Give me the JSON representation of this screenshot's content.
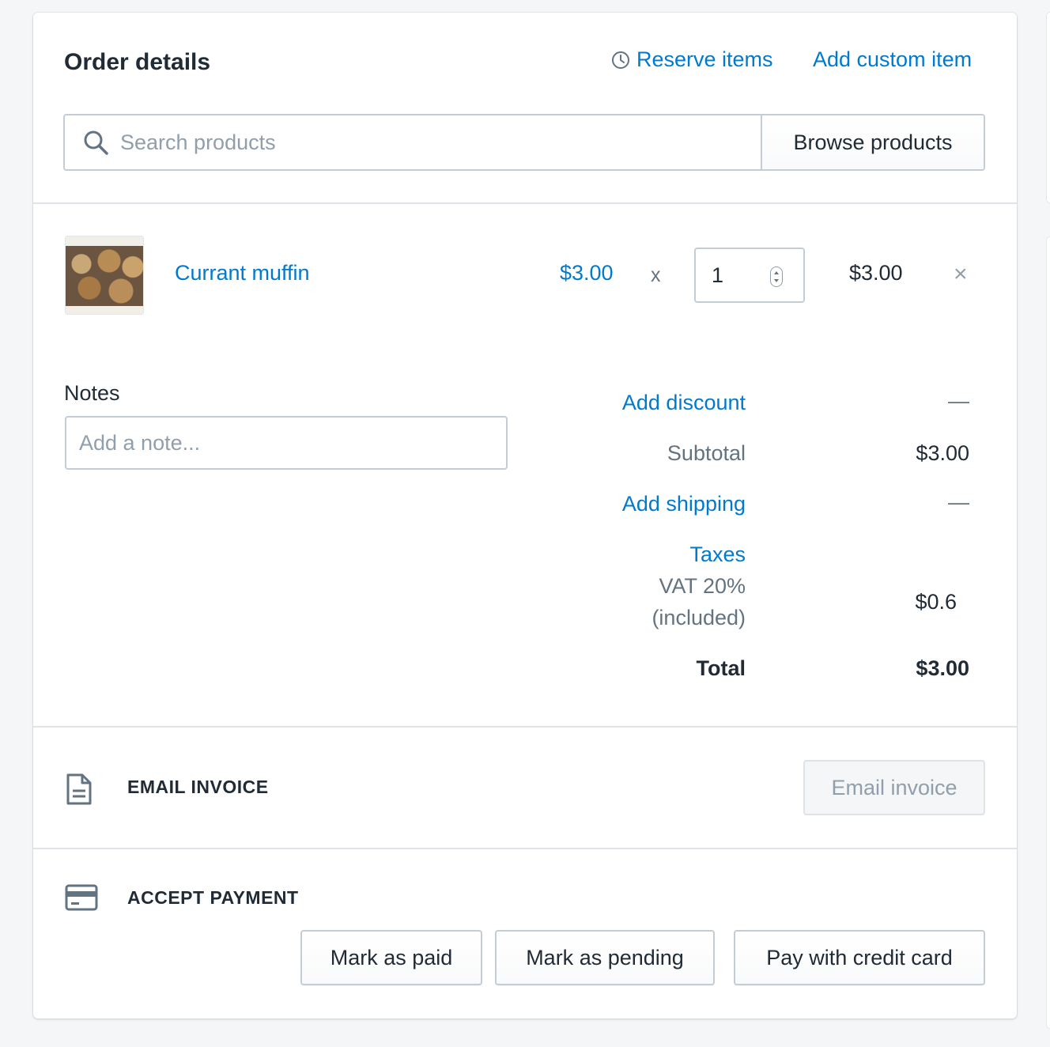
{
  "header": {
    "title": "Order details",
    "reserve_items": "Reserve items",
    "add_custom_item": "Add custom item"
  },
  "search": {
    "placeholder": "Search products",
    "browse_label": "Browse products"
  },
  "line_item": {
    "name": "Currant muffin",
    "unit_price": "$3.00",
    "times": "x",
    "quantity": "1",
    "total": "$3.00",
    "remove": "×"
  },
  "notes": {
    "label": "Notes",
    "placeholder": "Add a note..."
  },
  "summary": {
    "discount_label": "Add discount",
    "discount_value": "—",
    "subtotal_label": "Subtotal",
    "subtotal_value": "$3.00",
    "shipping_label": "Add shipping",
    "shipping_value": "—",
    "taxes_label": "Taxes",
    "tax_rate": "VAT 20%",
    "tax_included": "(included)",
    "tax_value": "$0.6",
    "total_label": "Total",
    "total_value": "$3.00"
  },
  "email_invoice": {
    "title": "EMAIL INVOICE",
    "button": "Email invoice",
    "icon": "document-icon"
  },
  "accept_payment": {
    "title": "ACCEPT PAYMENT",
    "icon": "credit-card-icon",
    "mark_paid": "Mark as paid",
    "mark_pending": "Mark as pending",
    "pay_card": "Pay with credit card"
  },
  "colors": {
    "link": "#007ace",
    "text": "#212b36",
    "muted": "#637381",
    "border": "#c4cdd5",
    "background": "#f4f6f8"
  }
}
